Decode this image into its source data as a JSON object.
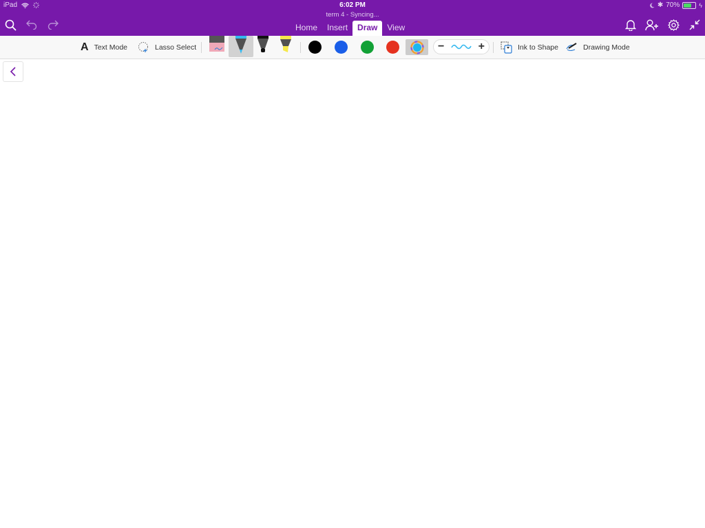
{
  "status_bar": {
    "device": "iPad",
    "time": "6:02 PM",
    "battery_percent": "70%",
    "battery_level": 0.7
  },
  "header": {
    "subtitle": "term 4 - Syncing...",
    "tabs": [
      {
        "label": "Home",
        "active": false
      },
      {
        "label": "Insert",
        "active": false
      },
      {
        "label": "Draw",
        "active": true
      },
      {
        "label": "View",
        "active": false
      }
    ],
    "left_icons": [
      "search-icon",
      "undo-icon",
      "redo-icon"
    ],
    "right_icons": [
      "bell-icon",
      "share-person-icon",
      "gear-icon",
      "collapse-icon"
    ]
  },
  "ribbon": {
    "text_mode_label": "Text Mode",
    "lasso_select_label": "Lasso Select",
    "tools": [
      "eraser",
      "pen",
      "marker",
      "highlighter"
    ],
    "selected_tool": "pen",
    "colors": [
      {
        "name": "black",
        "hex": "#000000"
      },
      {
        "name": "blue",
        "hex": "#1a5ee8"
      },
      {
        "name": "green",
        "hex": "#12a136"
      },
      {
        "name": "red",
        "hex": "#e5321f"
      }
    ],
    "selected_color_hex": "#1ab6f0",
    "ink_to_shape_label": "Ink to Shape",
    "drawing_mode_label": "Drawing Mode"
  },
  "theme": {
    "accent": "#7719aa"
  }
}
